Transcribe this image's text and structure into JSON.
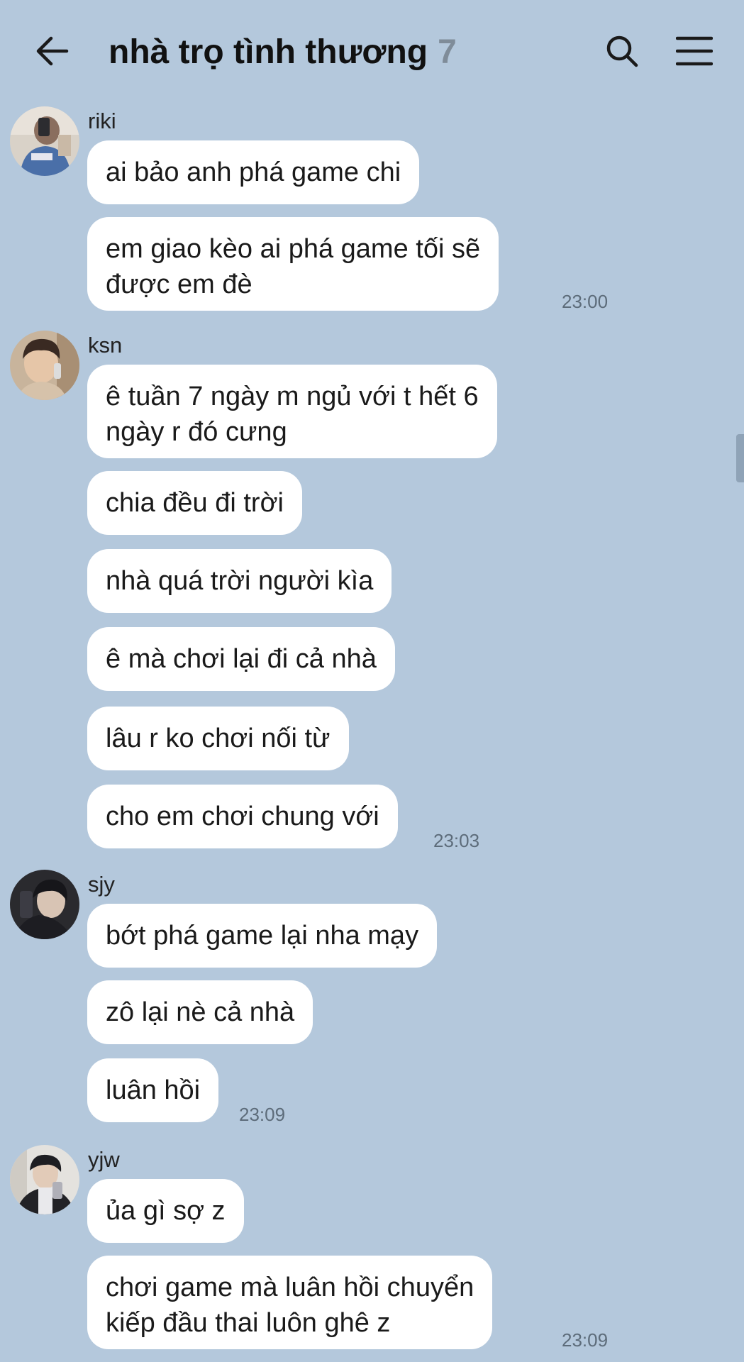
{
  "header": {
    "back_icon": "arrow-left-icon",
    "title": "nhà trọ tình thương",
    "member_count": "7",
    "search_icon": "search-icon",
    "menu_icon": "hamburger-menu-icon"
  },
  "colors": {
    "background": "#b4c8dc",
    "bubble": "#ffffff",
    "count_gray": "#7f8c99",
    "timestamp": "#5d6c7a"
  },
  "messages": [
    {
      "sender": "riki",
      "bubbles": [
        "ai bảo anh phá game chi",
        "em giao kèo ai phá game tối sẽ\nđược em đè"
      ],
      "time": "23:00"
    },
    {
      "sender": "ksn",
      "bubbles": [
        "ê tuần 7 ngày m ngủ với t hết 6\nngày r đó cưng",
        "chia đều đi trời",
        "nhà quá trời người kìa",
        "ê mà chơi lại đi cả nhà",
        "lâu r ko chơi nối từ",
        "cho em chơi chung với"
      ],
      "time": "23:03"
    },
    {
      "sender": "sjy",
      "bubbles": [
        "bớt phá game lại nha mạy",
        "zô lại nè cả nhà",
        "luân hồi"
      ],
      "time": "23:09"
    },
    {
      "sender": "yjw",
      "bubbles": [
        "ủa gì sợ z",
        "chơi game mà luân hồi chuyển\nkiếp đầu thai luôn ghê z"
      ],
      "time": "23:09"
    }
  ]
}
